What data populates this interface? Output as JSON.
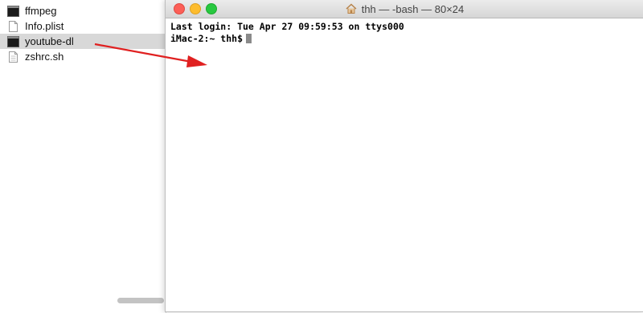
{
  "finder": {
    "files": [
      {
        "name": "ffmpeg",
        "icon": "executable-icon",
        "selected": false
      },
      {
        "name": "Info.plist",
        "icon": "document-icon",
        "selected": false
      },
      {
        "name": "youtube-dl",
        "icon": "executable-icon",
        "selected": true
      },
      {
        "name": "zshrc.sh",
        "icon": "document-icon",
        "selected": false
      }
    ]
  },
  "terminal": {
    "title": "thh — -bash — 80×24",
    "lines": {
      "login": "Last login: Tue Apr 27 09:59:53 on ttys000",
      "prompt": "iMac-2:~ thh$"
    }
  },
  "colors": {
    "close": "#fc5f57",
    "minimize": "#fdbc2e",
    "maximize": "#28c840",
    "annotation_arrow": "#e02020",
    "selection": "#d8d8d8"
  }
}
